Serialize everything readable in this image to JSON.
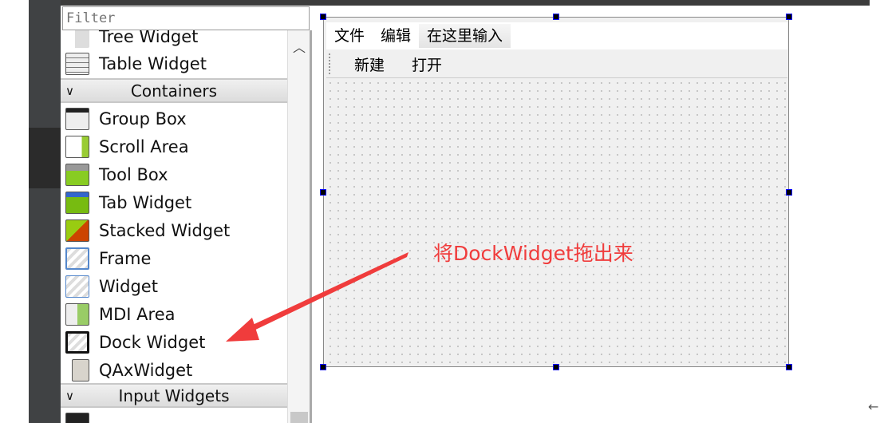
{
  "filter": {
    "placeholder": "Filter"
  },
  "widget_box": {
    "items_top": [
      {
        "label": "Tree Widget",
        "icon": "tree-widget-icon"
      },
      {
        "label": "Table Widget",
        "icon": "table-widget-icon"
      }
    ],
    "categories": [
      {
        "label": "Containers"
      },
      {
        "label": "Input Widgets"
      }
    ],
    "containers": [
      {
        "label": "Group Box",
        "icon": "group-box-icon"
      },
      {
        "label": "Scroll Area",
        "icon": "scroll-area-icon"
      },
      {
        "label": "Tool Box",
        "icon": "tool-box-icon"
      },
      {
        "label": "Tab Widget",
        "icon": "tab-widget-icon"
      },
      {
        "label": "Stacked Widget",
        "icon": "stacked-widget-icon"
      },
      {
        "label": "Frame",
        "icon": "frame-icon"
      },
      {
        "label": "Widget",
        "icon": "widget-icon"
      },
      {
        "label": "MDI Area",
        "icon": "mdi-area-icon"
      },
      {
        "label": "Dock Widget",
        "icon": "dock-widget-icon"
      },
      {
        "label": "QAxWidget",
        "icon": "qaxwidget-icon"
      }
    ]
  },
  "form": {
    "menu": [
      "文件",
      "编辑",
      "在这里输入"
    ],
    "toolbar": [
      "新建",
      "打开"
    ]
  },
  "annotation": {
    "text": "将DockWidget拖出来",
    "color": "#f03c3c"
  }
}
